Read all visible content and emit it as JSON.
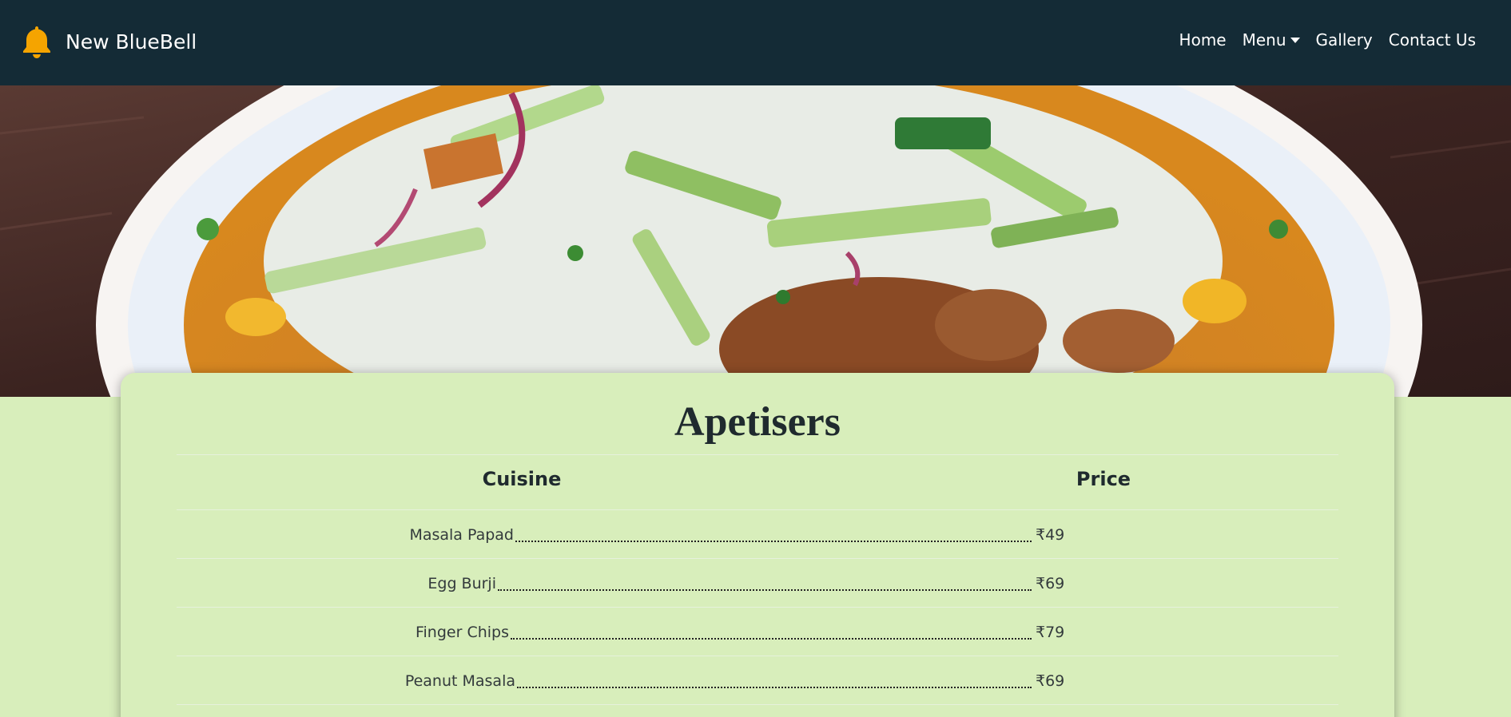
{
  "navbar": {
    "brand_name": "New BlueBell",
    "brand_icon": "bell-icon",
    "links": [
      {
        "label": "Home"
      },
      {
        "label": "Menu",
        "dropdown": true
      },
      {
        "label": "Gallery"
      },
      {
        "label": "Contact Us"
      }
    ]
  },
  "hero": {
    "image": "food-plate-photo"
  },
  "menu_section": {
    "title": "Apetisers",
    "headers": {
      "cuisine": "Cuisine",
      "price": "Price"
    },
    "items": [
      {
        "name": "Masala Papad",
        "price": "₹49"
      },
      {
        "name": "Egg Burji",
        "price": "₹69"
      },
      {
        "name": "Finger Chips",
        "price": "₹79"
      },
      {
        "name": "Peanut Masala",
        "price": "₹69"
      }
    ]
  },
  "colors": {
    "navbar_bg": "#142b36",
    "page_bg": "#d8eebb",
    "bell": "#f5a400"
  }
}
